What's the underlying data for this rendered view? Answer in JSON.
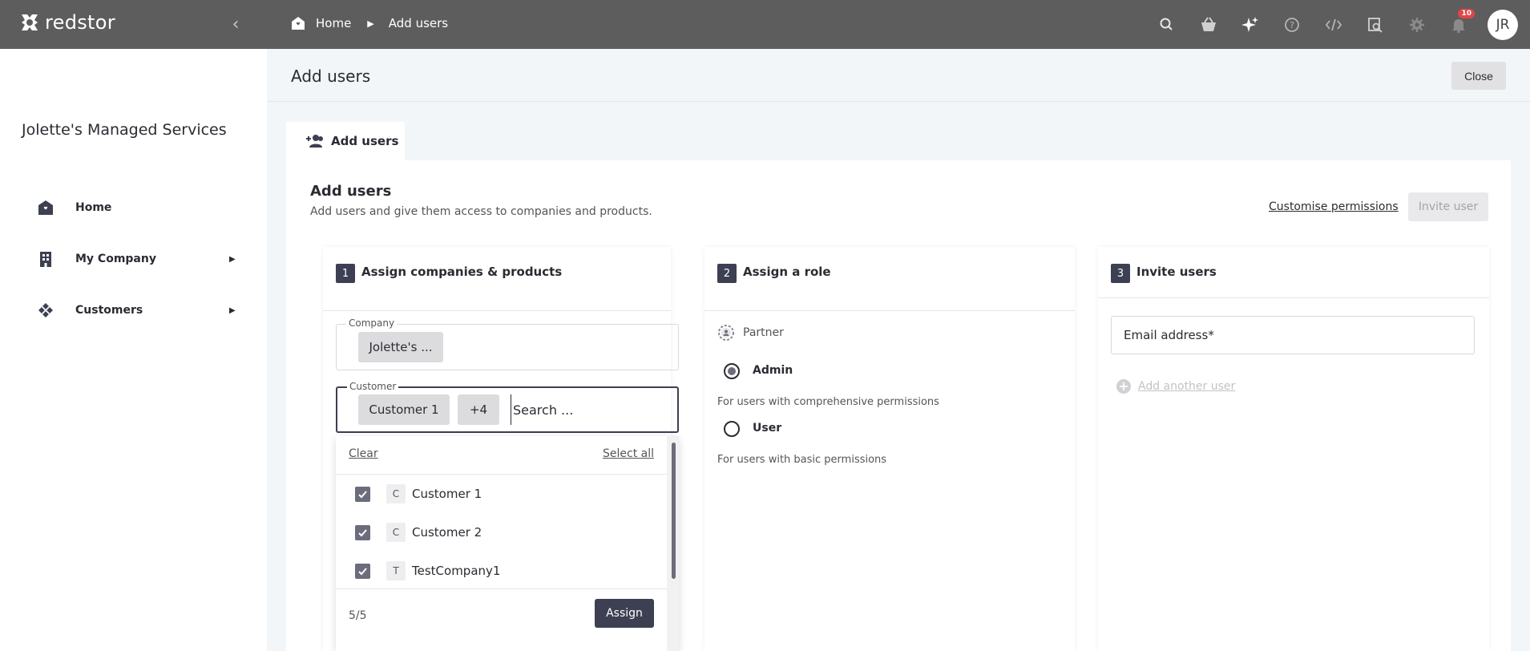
{
  "app": {
    "logo_text": "redstor"
  },
  "breadcrumb": {
    "home": "Home",
    "current": "Add users"
  },
  "topbar": {
    "notifications_count": "10",
    "avatar_initials": "JR",
    "icons": [
      "search-icon",
      "basket-icon",
      "sparkle-icon",
      "help-icon",
      "code-icon",
      "inspect-icon",
      "gear-icon",
      "bell-icon"
    ]
  },
  "sidebar": {
    "org_name": "Jolette's Managed Services",
    "items": [
      {
        "label": "Home",
        "icon": "home-icon",
        "expandable": false
      },
      {
        "label": "My Company",
        "icon": "building-icon",
        "expandable": true
      },
      {
        "label": "Customers",
        "icon": "customers-icon",
        "expandable": true
      }
    ]
  },
  "page": {
    "title": "Add users",
    "close_label": "Close"
  },
  "tab": {
    "label": "Add users"
  },
  "card": {
    "title": "Add users",
    "subtitle": "Add users and give them access to companies and products.",
    "customise_permissions": "Customise permissions",
    "invite_button": "Invite user"
  },
  "step1": {
    "number": "1",
    "label": "Assign companies & products",
    "company_legend": "Company",
    "company_chip": "Jolette's ...",
    "customer_legend": "Customer",
    "customer_chip": "Customer 1",
    "more_chip": "+4",
    "search_placeholder": "Search ...",
    "dropdown": {
      "clear": "Clear",
      "select_all": "Select all",
      "items": [
        {
          "initial": "C",
          "name": "Customer 1",
          "checked": true
        },
        {
          "initial": "C",
          "name": "Customer 2",
          "checked": true
        },
        {
          "initial": "T",
          "name": "TestCompany1",
          "checked": true
        }
      ],
      "count": "5/5",
      "assign": "Assign"
    }
  },
  "step2": {
    "number": "2",
    "label": "Assign a role",
    "partner": "Partner",
    "roles": [
      {
        "label": "Admin",
        "desc": "For users with comprehensive permissions",
        "selected": true
      },
      {
        "label": "User",
        "desc": "For users with basic permissions",
        "selected": false
      }
    ]
  },
  "step3": {
    "number": "3",
    "label": "Invite users",
    "email_placeholder": "Email address*",
    "add_another": "Add another user"
  }
}
